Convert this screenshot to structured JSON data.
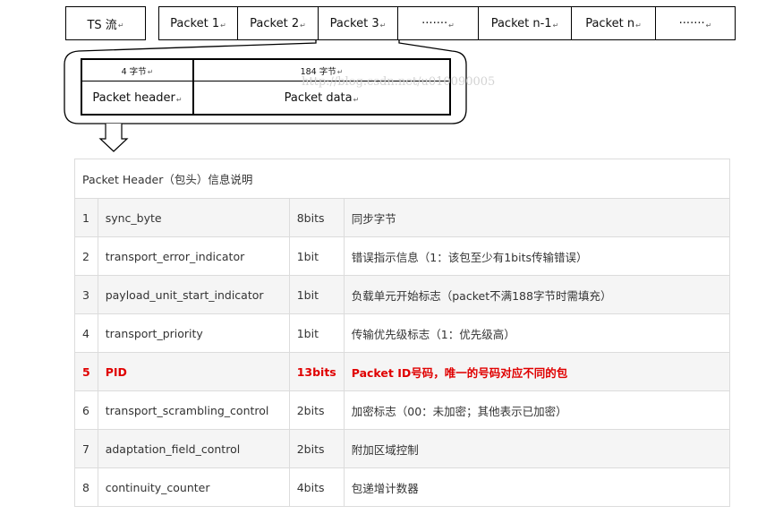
{
  "ts_row": {
    "label": "TS 流",
    "packets": [
      "Packet 1",
      "Packet 2",
      "Packet 3",
      "·······",
      "Packet n-1",
      "Packet n",
      "·······"
    ]
  },
  "packet_detail": {
    "header_size": "4 字节",
    "data_size": "184 字节",
    "header_label": "Packet header",
    "data_label": "Packet data",
    "watermark": "http://blog.csdn.net/u010090005"
  },
  "header_table": {
    "caption": "Packet Header（包头）信息说明",
    "highlight_color": "#e00000",
    "rows": [
      {
        "num": "1",
        "name": "sync_byte",
        "bits": "8bits",
        "desc": "同步字节",
        "highlight": false
      },
      {
        "num": "2",
        "name": "transport_error_indicator",
        "bits": "1bit",
        "desc": "错误指示信息（1：该包至少有1bits传输错误）",
        "highlight": false
      },
      {
        "num": "3",
        "name": "payload_unit_start_indicator",
        "bits": "1bit",
        "desc": "负载单元开始标志（packet不满188字节时需填充）",
        "highlight": false
      },
      {
        "num": "4",
        "name": "transport_priority",
        "bits": "1bit",
        "desc": "传输优先级标志（1：优先级高）",
        "highlight": false
      },
      {
        "num": "5",
        "name": "PID",
        "bits": "13bits",
        "desc": "Packet ID号码，唯一的号码对应不同的包",
        "highlight": true
      },
      {
        "num": "6",
        "name": "transport_scrambling_control",
        "bits": "2bits",
        "desc": "加密标志（00：未加密；其他表示已加密）",
        "highlight": false
      },
      {
        "num": "7",
        "name": "adaptation_field_control",
        "bits": "2bits",
        "desc": "附加区域控制",
        "highlight": false
      },
      {
        "num": "8",
        "name": "continuity_counter",
        "bits": "4bits",
        "desc": "包递增计数器",
        "highlight": false
      }
    ]
  }
}
